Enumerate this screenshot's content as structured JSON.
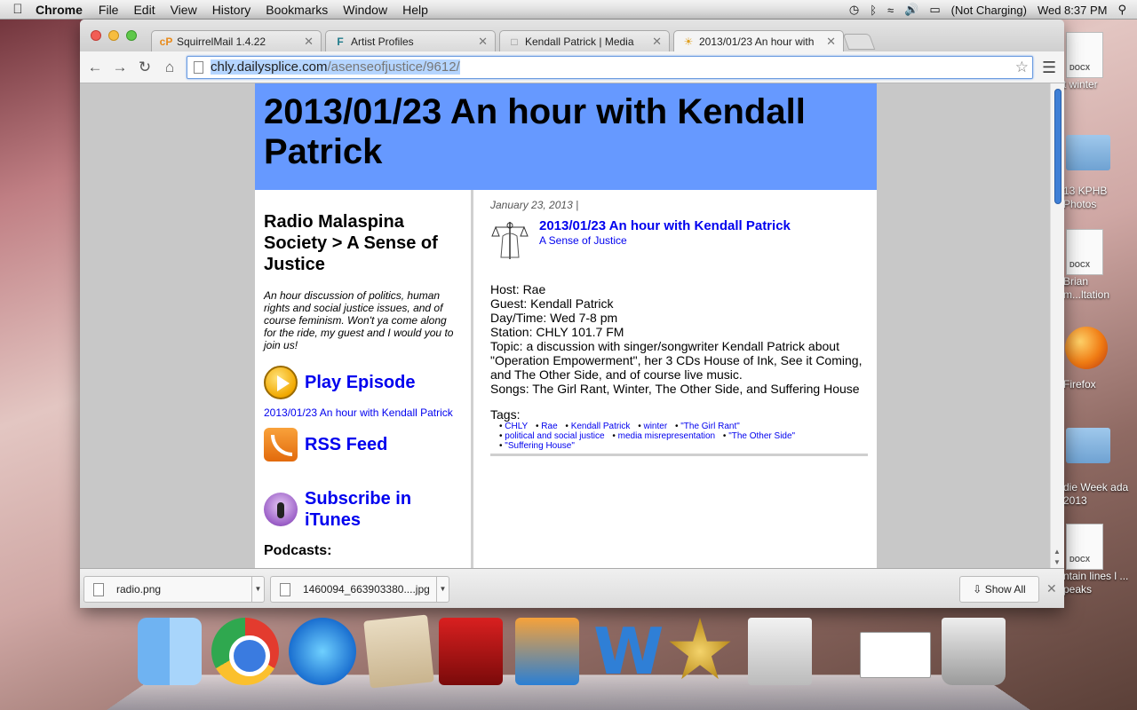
{
  "menubar": {
    "app_name": "Chrome",
    "menus": [
      "File",
      "Edit",
      "View",
      "History",
      "Bookmarks",
      "Window",
      "Help"
    ],
    "battery": "(Not Charging)",
    "clock": "Wed 8:37 PM"
  },
  "desktop": {
    "icons": [
      {
        "label": "DOCX",
        "caption": "t winter"
      },
      {
        "caption": "13 KPHB Photos"
      },
      {
        "label": "DOCX",
        "caption": "Brian m...ltation"
      },
      {
        "caption": "Firefox"
      },
      {
        "caption": "die Week ada 2013"
      },
      {
        "label": "DOCX",
        "caption": "ntain lines l ... peaks"
      }
    ]
  },
  "browser": {
    "tabs": [
      {
        "favicon": "cP",
        "title": "SquirrelMail 1.4.22"
      },
      {
        "favicon": "F",
        "title": "Artist Profiles"
      },
      {
        "favicon": "page-icon",
        "title": "Kendall Patrick | Media"
      },
      {
        "favicon": "sun-icon",
        "title": "2013/01/23 An hour with"
      }
    ],
    "url_host": "chly.dailysplice.com",
    "url_path": "/asenseofjustice/9612/"
  },
  "page": {
    "header_title": "2013/01/23 An hour with Kendall Patrick",
    "sidebar": {
      "heading": "Radio Malaspina Society > A Sense of Justice",
      "description": "An hour discussion of politics, human rights and social justice issues, and of course feminism. Won't ya come along for the ride, my guest and I would you to join us!",
      "play_label": "Play Episode",
      "episode_link": "2013/01/23 An hour with Kendall Patrick",
      "rss_label": "RSS Feed",
      "itunes_label": "Subscribe in iTunes",
      "podcasts_label": "Podcasts:"
    },
    "post": {
      "date": "January 23, 2013 |",
      "title": "2013/01/23 An hour with Kendall Patrick",
      "category": "A Sense of Justice",
      "lines": [
        "Host: Rae",
        "Guest: Kendall Patrick",
        "Day/Time: Wed 7-8 pm",
        "Station: CHLY 101.7 FM",
        "Topic: a discussion with singer/songwriter Kendall Patrick about \"Operation Empowerment\", her 3 CDs House of Ink, See it Coming, and The Other Side, and of course live music.",
        "Songs: The Girl Rant, Winter, The Other Side, and Suffering House"
      ],
      "tags_label": "Tags:",
      "tags": [
        "CHLY",
        "Rae",
        "Kendall Patrick",
        "winter",
        "\"The Girl Rant\"",
        "political and social justice",
        "media misrepresentation",
        "\"The Other Side\"",
        "\"Suffering House\""
      ]
    }
  },
  "downloads": {
    "items": [
      "radio.png",
      "1460094_663903380....jpg"
    ],
    "show_all": "Show All"
  },
  "colors": {
    "header_bg": "#6699ff",
    "link": "#0000ee"
  }
}
